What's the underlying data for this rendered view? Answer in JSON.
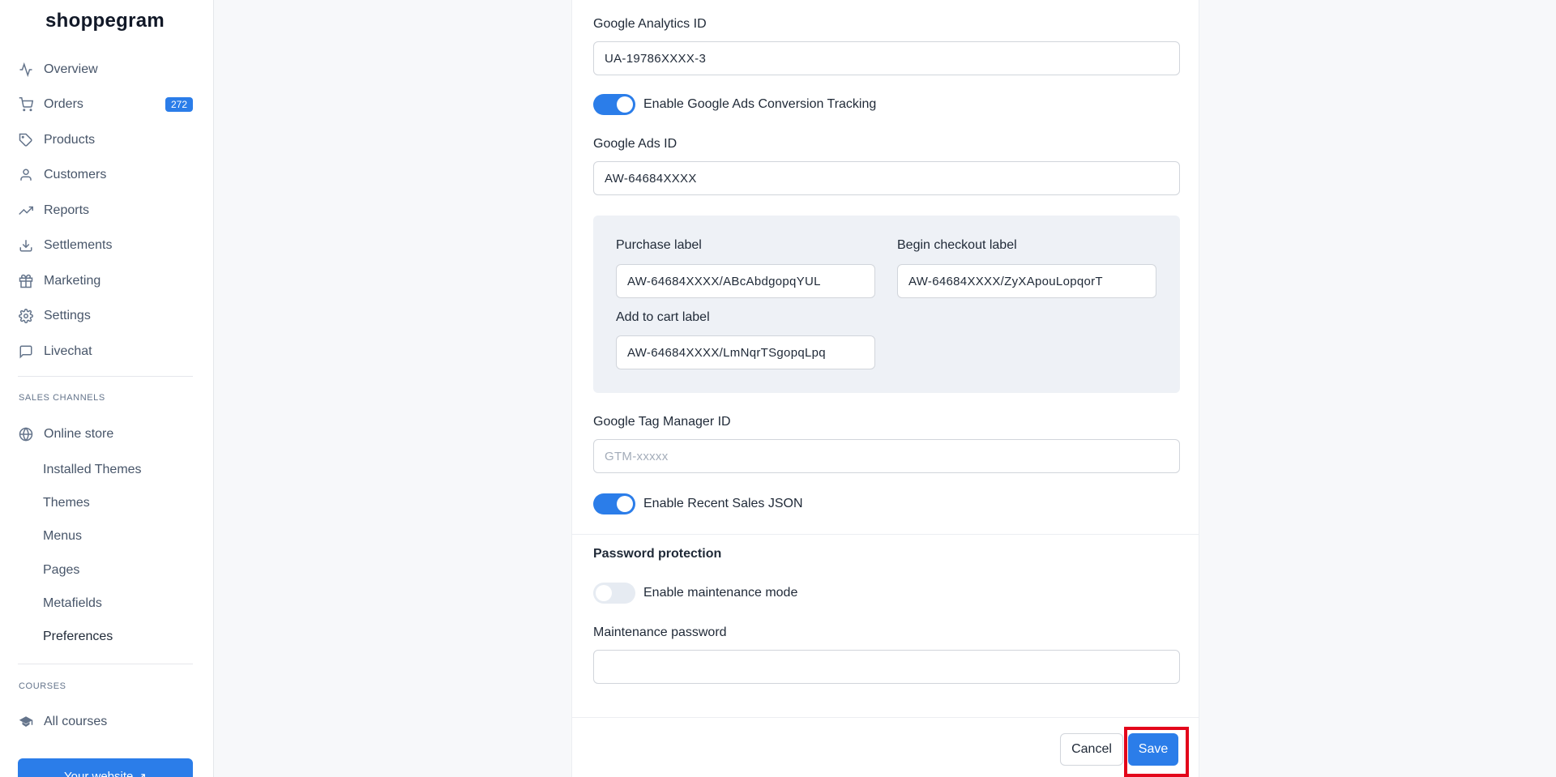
{
  "app": {
    "logo": "shoppegram"
  },
  "sidebar": {
    "nav": [
      {
        "label": "Overview",
        "icon": "activity-icon"
      },
      {
        "label": "Orders",
        "icon": "cart-icon",
        "badge": "272"
      },
      {
        "label": "Products",
        "icon": "tag-icon"
      },
      {
        "label": "Customers",
        "icon": "user-icon"
      },
      {
        "label": "Reports",
        "icon": "trending-up-icon"
      },
      {
        "label": "Settlements",
        "icon": "download-icon"
      },
      {
        "label": "Marketing",
        "icon": "gift-icon"
      },
      {
        "label": "Settings",
        "icon": "gear-icon"
      },
      {
        "label": "Livechat",
        "icon": "chat-icon"
      }
    ],
    "sales_channels_title": "SALES CHANNELS",
    "online_store": {
      "label": "Online store",
      "icon": "globe-icon"
    },
    "online_store_sub": [
      "Installed Themes",
      "Themes",
      "Menus",
      "Pages",
      "Metafields",
      "Preferences"
    ],
    "courses_title": "COURSES",
    "all_courses": {
      "label": "All courses",
      "icon": "graduation-cap-icon"
    },
    "website_button": "Your website"
  },
  "form": {
    "ga_id_label": "Google Analytics ID",
    "ga_id_value": "UA-19786XXXX-3",
    "ads_tracking_label": "Enable Google Ads Conversion Tracking",
    "ads_tracking_enabled": true,
    "ads_id_label": "Google Ads ID",
    "ads_id_value": "AW-64684XXXX",
    "purchase_label": "Purchase label",
    "purchase_value": "AW-64684XXXX/ABcAbdgopqYUL",
    "checkout_label": "Begin checkout label",
    "checkout_value": "AW-64684XXXX/ZyXApouLopqorT",
    "cart_label": "Add to cart label",
    "cart_value": "AW-64684XXXX/LmNqrTSgopqLpq",
    "gtm_label": "Google Tag Manager ID",
    "gtm_placeholder": "GTM-xxxxx",
    "recent_sales_label": "Enable Recent Sales JSON",
    "recent_sales_enabled": true,
    "password_section_title": "Password protection",
    "maintenance_label": "Enable maintenance mode",
    "maintenance_enabled": false,
    "maintenance_password_label": "Maintenance password",
    "maintenance_password_value": ""
  },
  "actions": {
    "cancel": "Cancel",
    "save": "Save"
  },
  "colors": {
    "accent": "#2b7de9",
    "highlight": "#e3061b"
  }
}
